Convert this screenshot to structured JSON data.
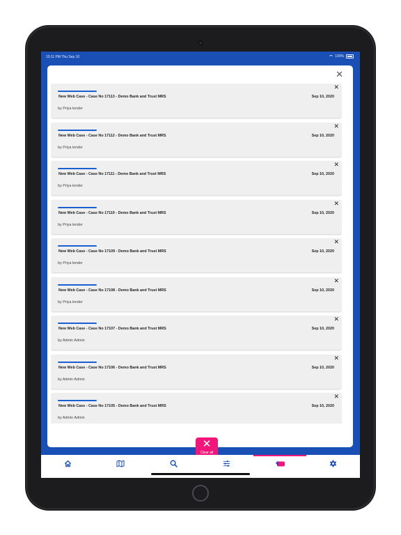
{
  "status_bar": {
    "time": "10:11 PM   Thu Sep 10",
    "battery": "100%"
  },
  "modal": {
    "close_icon": "close-icon"
  },
  "notifications": [
    {
      "title": "New Web Case - Case No 17113 - Demo Bank and Trust MRS",
      "date": "Sep 10, 2020",
      "author": "by Priya lender"
    },
    {
      "title": "New Web Case - Case No 17112 - Demo Bank and Trust MRS",
      "date": "Sep 10, 2020",
      "author": "by Priya lender"
    },
    {
      "title": "New Web Case - Case No 17111 - Demo Bank and Trust MRS",
      "date": "Sep 10, 2020",
      "author": "by Priya lender"
    },
    {
      "title": "New Web Case - Case No 17110 - Demo Bank and Trust MRS",
      "date": "Sep 10, 2020",
      "author": "by Priya lender"
    },
    {
      "title": "New Web Case - Case No 17109 - Demo Bank and Trust MRS",
      "date": "Sep 10, 2020",
      "author": "by Priya lender"
    },
    {
      "title": "New Web Case - Case No 17108 - Demo Bank and Trust MRS",
      "date": "Sep 10, 2020",
      "author": "by Priya lender"
    },
    {
      "title": "New Web Case - Case No 17107 - Demo Bank and Trust MRS",
      "date": "Sep 10, 2020",
      "author": "by Admin Admin"
    },
    {
      "title": "New Web Case - Case No 17106 - Demo Bank and Trust MRS",
      "date": "Sep 10, 2020",
      "author": "by Admin Admin"
    },
    {
      "title": "New Web Case - Case No 17105 - Demo Bank and Trust MRS",
      "date": "Sep 10, 2020",
      "author": "by Admin Admin"
    }
  ],
  "clear_all": {
    "label": "Clear all",
    "icon": "close-icon"
  },
  "tabs": [
    {
      "name": "home",
      "icon": "home-icon"
    },
    {
      "name": "map",
      "icon": "map-icon"
    },
    {
      "name": "search",
      "icon": "search-icon"
    },
    {
      "name": "filters",
      "icon": "sliders-icon"
    },
    {
      "name": "notifications",
      "icon": "notification-badge-icon",
      "active": true
    },
    {
      "name": "settings",
      "icon": "gear-icon"
    }
  ],
  "colors": {
    "brand_blue": "#1a4fb5",
    "accent_pink": "#f2167a",
    "card_bg": "#efefef",
    "accent_line": "#1a5fd1"
  }
}
